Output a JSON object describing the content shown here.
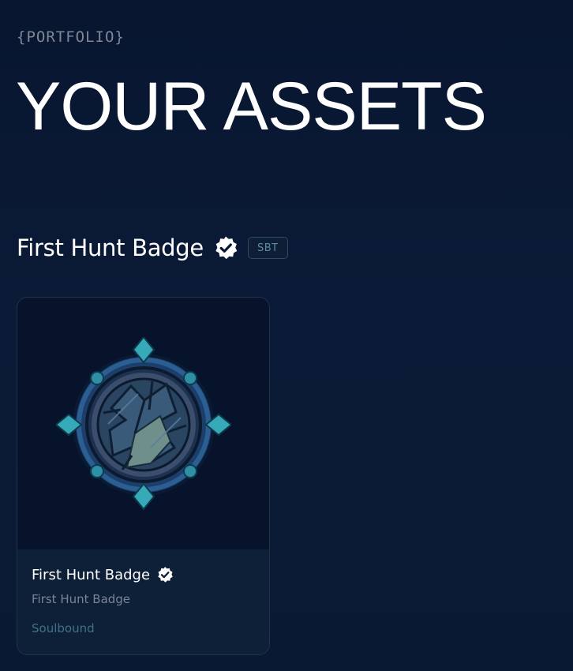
{
  "header": {
    "eyebrow": "{PORTFOLIO}",
    "title": "YOUR ASSETS"
  },
  "section": {
    "title": "First Hunt Badge",
    "verified_icon": "verified-badge-icon",
    "tag": "SBT"
  },
  "cards": [
    {
      "image": "first-hunt-badge-image",
      "title": "First Hunt Badge",
      "verified_icon": "verified-badge-icon",
      "subtitle": "First Hunt Badge",
      "type": "Soulbound"
    }
  ],
  "colors": {
    "background": "#0a1933",
    "card": "#0e1f38",
    "accent": "#3f7286",
    "muted_text": "#7b8494"
  }
}
